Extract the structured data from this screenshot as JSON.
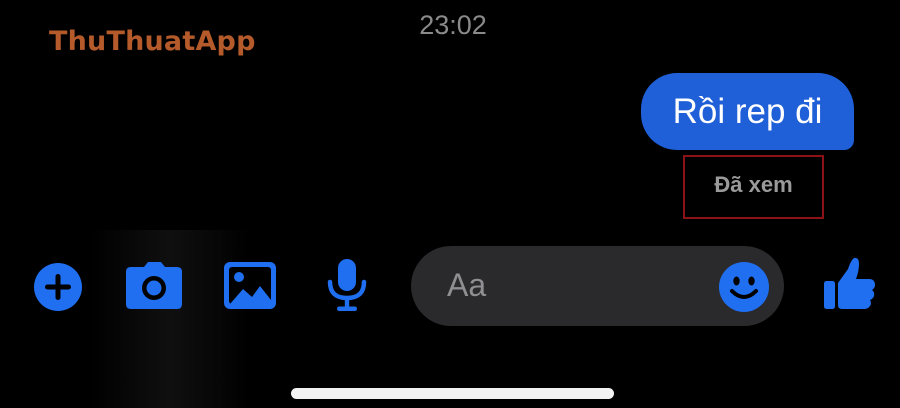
{
  "watermark": "ThuThuatApp",
  "status_bar": {
    "time": "23:02"
  },
  "message": {
    "text": "Rồi rep đi",
    "status": "Đã xem"
  },
  "composer": {
    "placeholder": "Aa",
    "icons": [
      "plus-icon",
      "camera-icon",
      "image-icon",
      "microphone-icon",
      "emoji-icon",
      "thumbs-up-icon"
    ]
  },
  "colors": {
    "accent": "#1f6ff0",
    "bubble": "#1f5fd8",
    "input_bg": "#2a2a2c",
    "watermark": "#b55a2a",
    "highlight": "#8c1218"
  }
}
